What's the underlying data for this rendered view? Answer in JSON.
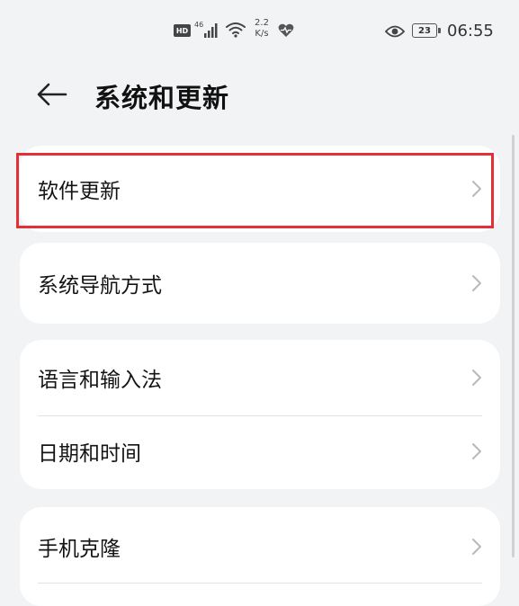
{
  "status_bar": {
    "hd_label": "HD",
    "network_label": "46",
    "speed_value": "2.2",
    "speed_unit": "K/s",
    "battery_level": "23",
    "time": "06:55"
  },
  "header": {
    "title": "系统和更新"
  },
  "groups": [
    {
      "items": [
        {
          "label": "软件更新",
          "highlighted": true
        }
      ]
    },
    {
      "items": [
        {
          "label": "系统导航方式"
        }
      ]
    },
    {
      "items": [
        {
          "label": "语言和输入法"
        },
        {
          "label": "日期和时间"
        }
      ]
    },
    {
      "items": [
        {
          "label": "手机克隆"
        }
      ]
    }
  ],
  "colors": {
    "background": "#f1f3f5",
    "card": "#ffffff",
    "highlight_border": "#e62e36",
    "chevron": "#b8b9bb"
  }
}
